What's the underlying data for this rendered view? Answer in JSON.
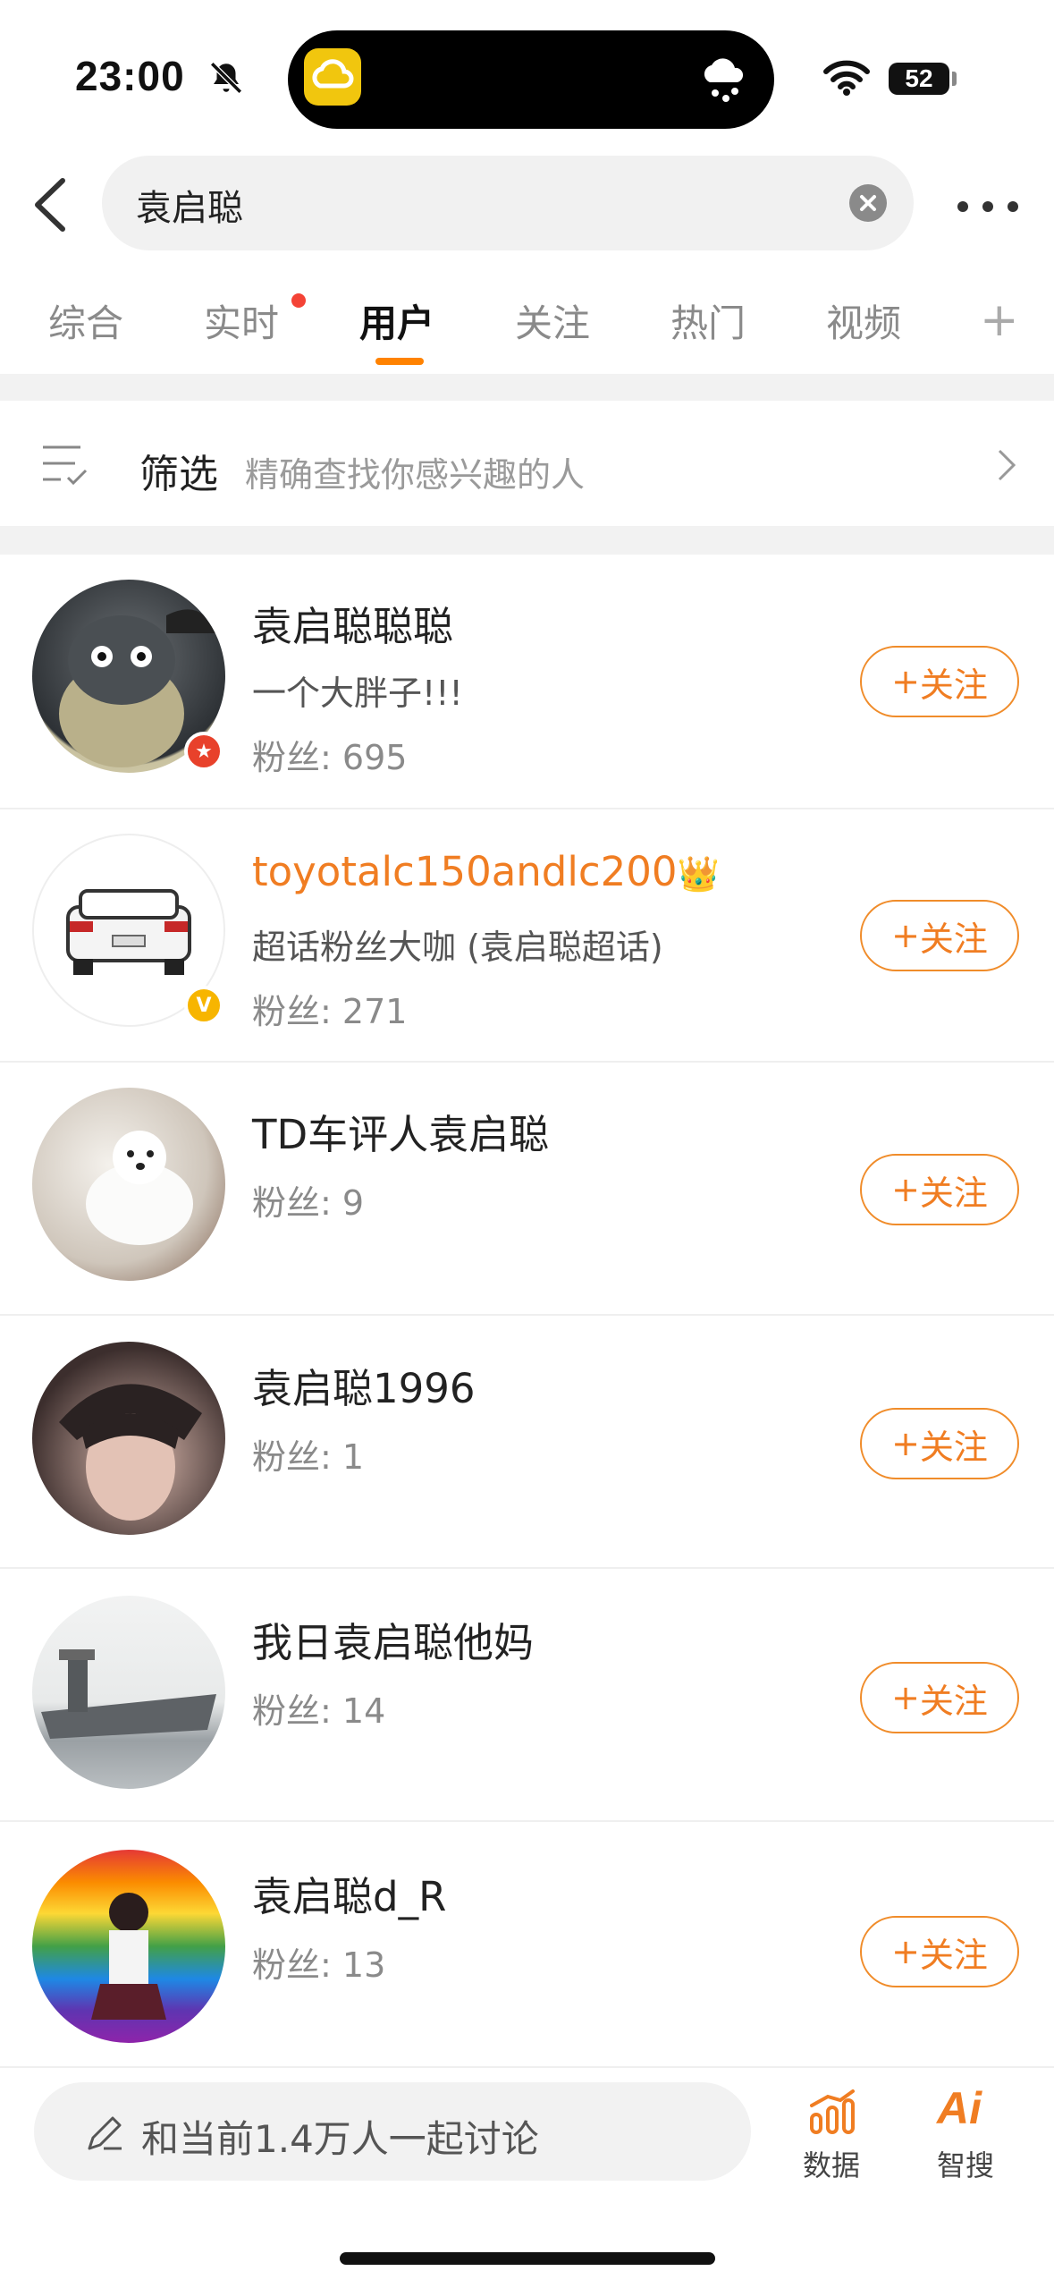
{
  "status_bar": {
    "time": "23:00",
    "battery": "52",
    "icons": [
      "bell-slash-icon",
      "weather-app-icon",
      "rain-cloud-icon",
      "wifi-icon",
      "battery-icon"
    ]
  },
  "search": {
    "query": "袁启聪"
  },
  "tabs": [
    {
      "label": "综合"
    },
    {
      "label": "实时"
    },
    {
      "label": "用户"
    },
    {
      "label": "关注"
    },
    {
      "label": "热门"
    },
    {
      "label": "视频"
    }
  ],
  "active_tab": "用户",
  "filter": {
    "label": "筛选",
    "hint": "精确查找你感兴趣的人"
  },
  "users": [
    {
      "name": "袁启聪聪聪",
      "desc": "一个大胖子!!!",
      "fans_label": "粉丝:",
      "fans": "695",
      "follow_label": "关注",
      "badge": "red-star"
    },
    {
      "name": "toyotalc150andlc200",
      "desc": "超话粉丝大咖 (袁启聪超话)",
      "fans_label": "粉丝:",
      "fans": "271",
      "follow_label": "关注",
      "badge": "yellow-v",
      "badge_text": "V"
    },
    {
      "name": "TD车评人袁启聪",
      "desc": "",
      "fans_label": "粉丝:",
      "fans": "9",
      "follow_label": "关注"
    },
    {
      "name": "袁启聪1996",
      "desc": "",
      "fans_label": "粉丝:",
      "fans": "1",
      "follow_label": "关注"
    },
    {
      "name": "我日袁启聪他妈",
      "desc": "",
      "fans_label": "粉丝:",
      "fans": "14",
      "follow_label": "关注"
    },
    {
      "name": "袁启聪d_R",
      "desc": "",
      "fans_label": "粉丝:",
      "fans": "13",
      "follow_label": "关注"
    }
  ],
  "bottom": {
    "discuss_placeholder": "和当前1.4万人一起讨论",
    "data_label": "数据",
    "ai_label": "智搜",
    "ai_icon_text": "Ai"
  },
  "colors": {
    "accent": "#ff8200",
    "follow": "#f07d22",
    "notify_dot": "#f44336"
  }
}
